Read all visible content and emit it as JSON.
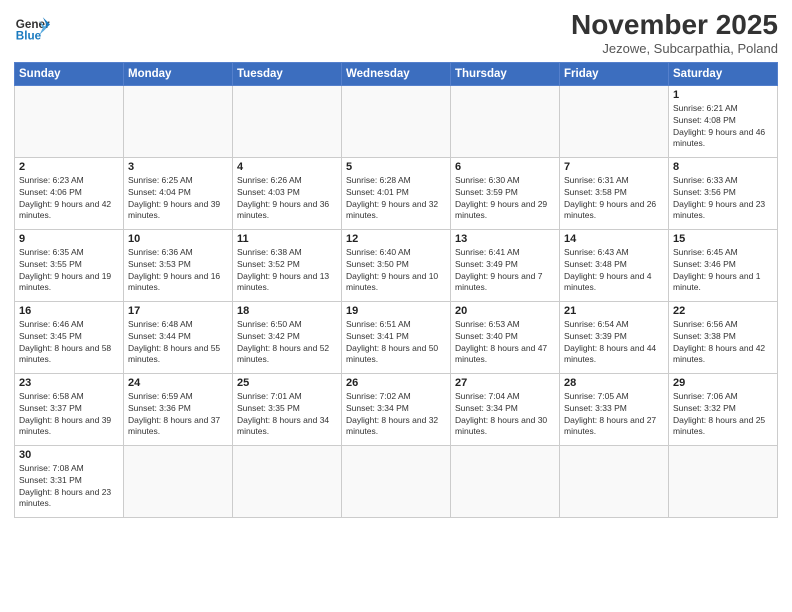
{
  "logo": {
    "text_general": "General",
    "text_blue": "Blue"
  },
  "header": {
    "month_title": "November 2025",
    "subtitle": "Jezowe, Subcarpathia, Poland"
  },
  "weekdays": [
    "Sunday",
    "Monday",
    "Tuesday",
    "Wednesday",
    "Thursday",
    "Friday",
    "Saturday"
  ],
  "weeks": [
    [
      null,
      null,
      null,
      null,
      null,
      null,
      {
        "day": 1,
        "sunrise": "6:21 AM",
        "sunset": "4:08 PM",
        "daylight": "9 hours and 46 minutes."
      }
    ],
    [
      {
        "day": 2,
        "sunrise": "6:23 AM",
        "sunset": "4:06 PM",
        "daylight": "9 hours and 42 minutes."
      },
      {
        "day": 3,
        "sunrise": "6:25 AM",
        "sunset": "4:04 PM",
        "daylight": "9 hours and 39 minutes."
      },
      {
        "day": 4,
        "sunrise": "6:26 AM",
        "sunset": "4:03 PM",
        "daylight": "9 hours and 36 minutes."
      },
      {
        "day": 5,
        "sunrise": "6:28 AM",
        "sunset": "4:01 PM",
        "daylight": "9 hours and 32 minutes."
      },
      {
        "day": 6,
        "sunrise": "6:30 AM",
        "sunset": "3:59 PM",
        "daylight": "9 hours and 29 minutes."
      },
      {
        "day": 7,
        "sunrise": "6:31 AM",
        "sunset": "3:58 PM",
        "daylight": "9 hours and 26 minutes."
      },
      {
        "day": 8,
        "sunrise": "6:33 AM",
        "sunset": "3:56 PM",
        "daylight": "9 hours and 23 minutes."
      }
    ],
    [
      {
        "day": 9,
        "sunrise": "6:35 AM",
        "sunset": "3:55 PM",
        "daylight": "9 hours and 19 minutes."
      },
      {
        "day": 10,
        "sunrise": "6:36 AM",
        "sunset": "3:53 PM",
        "daylight": "9 hours and 16 minutes."
      },
      {
        "day": 11,
        "sunrise": "6:38 AM",
        "sunset": "3:52 PM",
        "daylight": "9 hours and 13 minutes."
      },
      {
        "day": 12,
        "sunrise": "6:40 AM",
        "sunset": "3:50 PM",
        "daylight": "9 hours and 10 minutes."
      },
      {
        "day": 13,
        "sunrise": "6:41 AM",
        "sunset": "3:49 PM",
        "daylight": "9 hours and 7 minutes."
      },
      {
        "day": 14,
        "sunrise": "6:43 AM",
        "sunset": "3:48 PM",
        "daylight": "9 hours and 4 minutes."
      },
      {
        "day": 15,
        "sunrise": "6:45 AM",
        "sunset": "3:46 PM",
        "daylight": "9 hours and 1 minute."
      }
    ],
    [
      {
        "day": 16,
        "sunrise": "6:46 AM",
        "sunset": "3:45 PM",
        "daylight": "8 hours and 58 minutes."
      },
      {
        "day": 17,
        "sunrise": "6:48 AM",
        "sunset": "3:44 PM",
        "daylight": "8 hours and 55 minutes."
      },
      {
        "day": 18,
        "sunrise": "6:50 AM",
        "sunset": "3:42 PM",
        "daylight": "8 hours and 52 minutes."
      },
      {
        "day": 19,
        "sunrise": "6:51 AM",
        "sunset": "3:41 PM",
        "daylight": "8 hours and 50 minutes."
      },
      {
        "day": 20,
        "sunrise": "6:53 AM",
        "sunset": "3:40 PM",
        "daylight": "8 hours and 47 minutes."
      },
      {
        "day": 21,
        "sunrise": "6:54 AM",
        "sunset": "3:39 PM",
        "daylight": "8 hours and 44 minutes."
      },
      {
        "day": 22,
        "sunrise": "6:56 AM",
        "sunset": "3:38 PM",
        "daylight": "8 hours and 42 minutes."
      }
    ],
    [
      {
        "day": 23,
        "sunrise": "6:58 AM",
        "sunset": "3:37 PM",
        "daylight": "8 hours and 39 minutes."
      },
      {
        "day": 24,
        "sunrise": "6:59 AM",
        "sunset": "3:36 PM",
        "daylight": "8 hours and 37 minutes."
      },
      {
        "day": 25,
        "sunrise": "7:01 AM",
        "sunset": "3:35 PM",
        "daylight": "8 hours and 34 minutes."
      },
      {
        "day": 26,
        "sunrise": "7:02 AM",
        "sunset": "3:34 PM",
        "daylight": "8 hours and 32 minutes."
      },
      {
        "day": 27,
        "sunrise": "7:04 AM",
        "sunset": "3:34 PM",
        "daylight": "8 hours and 30 minutes."
      },
      {
        "day": 28,
        "sunrise": "7:05 AM",
        "sunset": "3:33 PM",
        "daylight": "8 hours and 27 minutes."
      },
      {
        "day": 29,
        "sunrise": "7:06 AM",
        "sunset": "3:32 PM",
        "daylight": "8 hours and 25 minutes."
      }
    ],
    [
      {
        "day": 30,
        "sunrise": "7:08 AM",
        "sunset": "3:31 PM",
        "daylight": "8 hours and 23 minutes."
      },
      null,
      null,
      null,
      null,
      null,
      null
    ]
  ]
}
